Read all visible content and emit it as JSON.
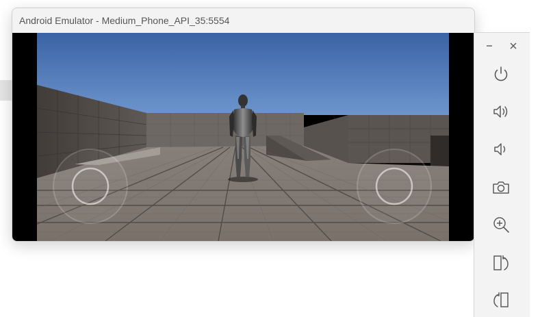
{
  "window": {
    "title": "Android Emulator - Medium_Phone_API_35:5554"
  },
  "game": {
    "left_joystick": "virtual-joystick",
    "right_joystick": "virtual-joystick"
  },
  "toolbar": {
    "icons": [
      "minimize-icon",
      "close-icon",
      "power-icon",
      "volume-up-icon",
      "volume-down-icon",
      "camera-icon",
      "zoom-in-icon",
      "rotate-right-icon",
      "rotate-left-icon"
    ]
  },
  "colors": {
    "sky": "#4672b4",
    "floor": "#7f776f",
    "chrome": "#f3f3f3",
    "icon": "#5a5a5a"
  }
}
